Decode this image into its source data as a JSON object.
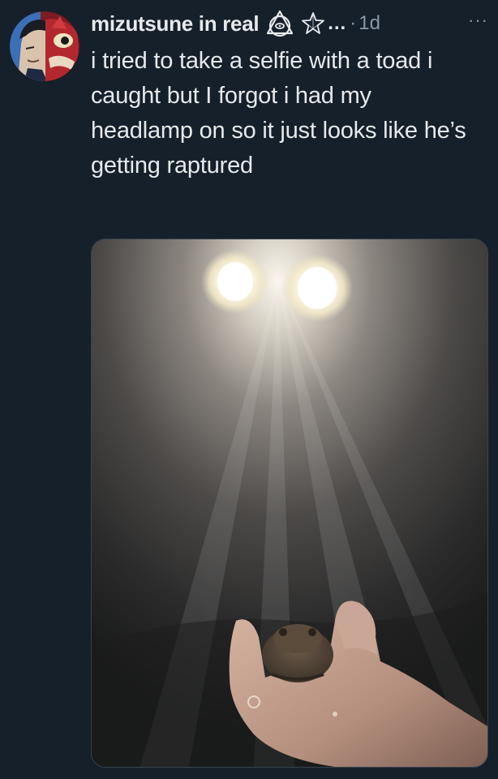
{
  "tweet": {
    "author": {
      "display_name": "mizutsune in real",
      "name_truncation": "…",
      "avatar_icon": "avatar-anime-character-icon",
      "name_emojis": [
        "alchemy-triangle-eye-icon",
        "star-outline-icon"
      ]
    },
    "separator": "·",
    "timestamp": "1d",
    "more_label": "···",
    "text": "i tried to take a selfie with a toad i caught but I forgot i had my headlamp on so it just looks like he’s getting raptured",
    "media": {
      "type": "photo",
      "subject": "toad-in-hand-photo"
    }
  },
  "colors": {
    "background": "#15202b",
    "text_primary": "#e7e9ea",
    "text_secondary": "#8b98a5",
    "border": "#38444d"
  }
}
